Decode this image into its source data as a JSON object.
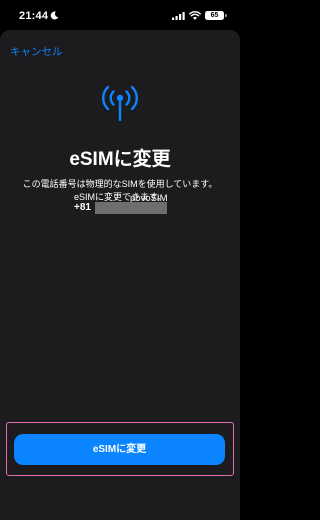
{
  "status_bar": {
    "time": "21:44",
    "battery": "65",
    "icons": [
      "moon-icon",
      "signal-icon",
      "wifi-icon",
      "battery-icon"
    ]
  },
  "header": {
    "cancel_label": "キャンセル"
  },
  "main": {
    "icon": "antenna-icon",
    "title": "eSIMに変更",
    "description_line1": "この電話番号は物理的なSIMを使用しています。",
    "description_line2": "eSIMに変更できます。",
    "carrier": "povoSIM",
    "phone_prefix": "+81"
  },
  "action": {
    "button_label": "eSIMに変更"
  },
  "colors": {
    "accent": "#0a84ff",
    "sheet_background": "#1c1c1e",
    "highlight_border": "#e46bb5"
  }
}
